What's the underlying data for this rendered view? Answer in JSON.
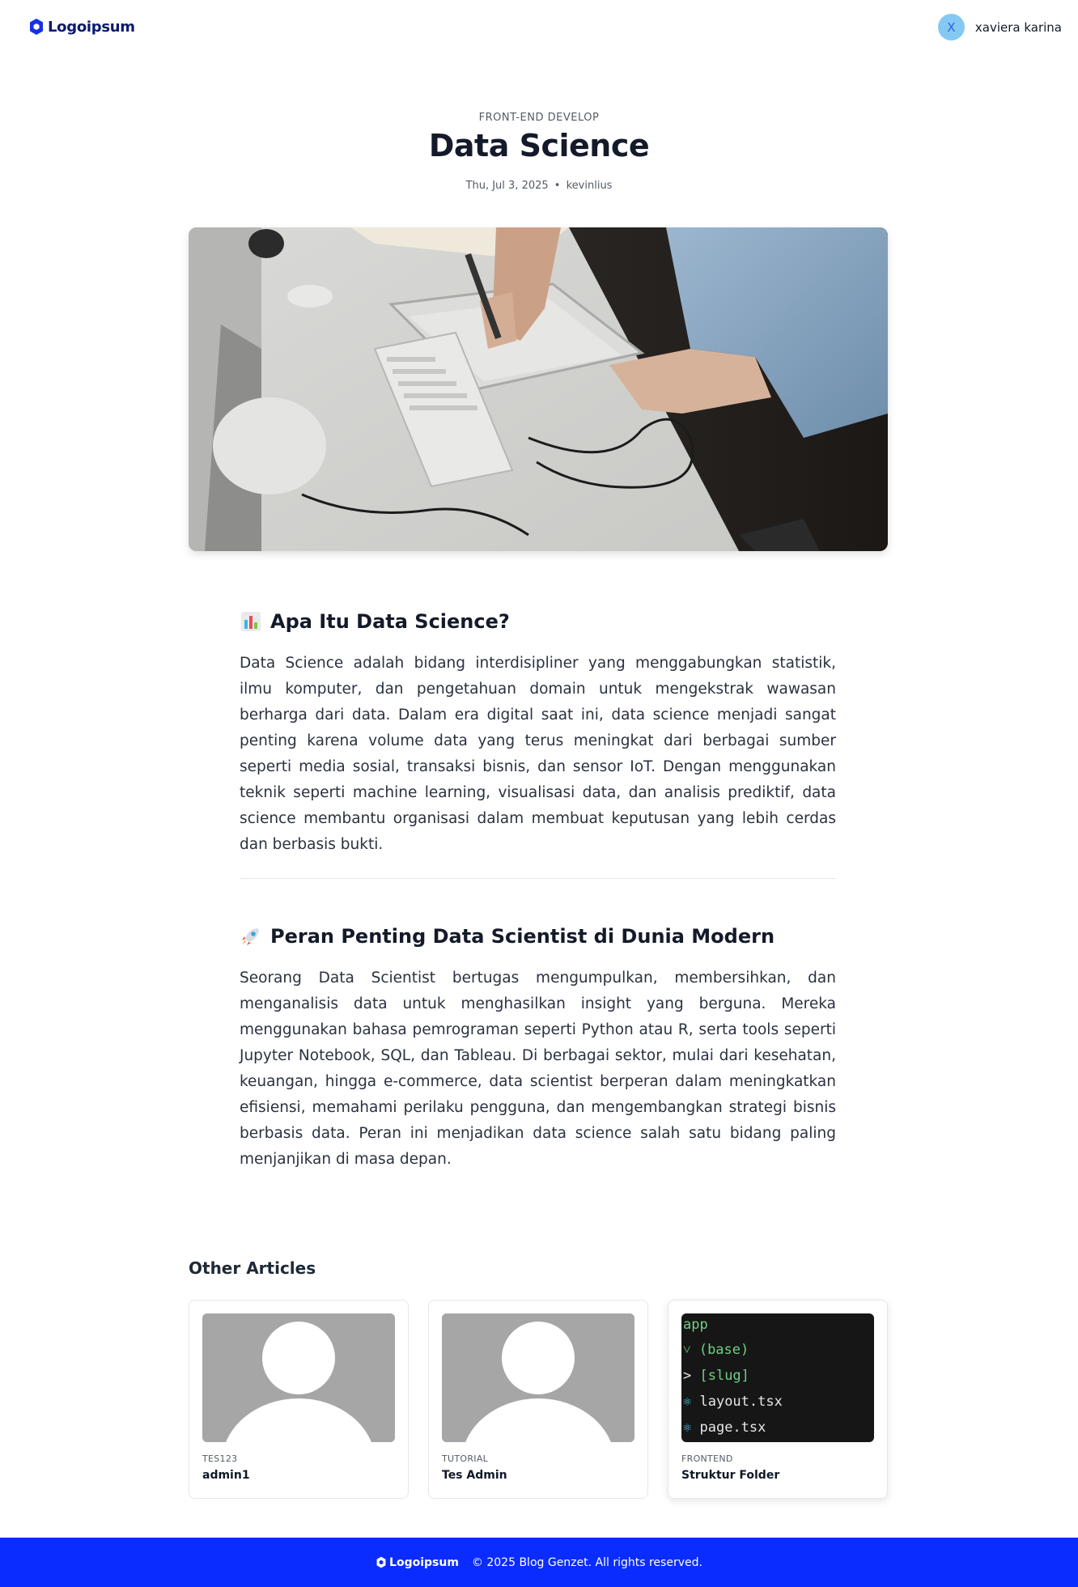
{
  "header": {
    "logo_text": "Logoipsum",
    "user": {
      "initial": "X",
      "name": "xaviera karina",
      "avatar_color": "#84c9f2"
    }
  },
  "article": {
    "category": "FRONT-END DEVELOP",
    "title": "Data Science",
    "date": "Thu, Jul 3, 2025",
    "separator": "•",
    "author": "kevinlius",
    "hero_image": "person-drawing-on-tablet-photo",
    "sections": [
      {
        "emoji": "chart-emoji-icon",
        "heading": "Apa Itu Data Science?",
        "body": "Data Science adalah bidang interdisipliner yang menggabungkan statistik, ilmu komputer, dan pengetahuan domain untuk mengekstrak wawasan berharga dari data. Dalam era digital saat ini, data science menjadi sangat penting karena volume data yang terus meningkat dari berbagai sumber seperti media sosial, transaksi bisnis, dan sensor IoT. Dengan menggunakan teknik seperti machine learning, visualisasi data, dan analisis prediktif, data science membantu organisasi dalam membuat keputusan yang lebih cerdas dan berbasis bukti."
      },
      {
        "emoji": "rocket-emoji-icon",
        "heading": "Peran Penting Data Scientist di Dunia Modern",
        "body": "Seorang Data Scientist bertugas mengumpulkan, membersihkan, dan menganalisis data untuk menghasilkan insight yang berguna. Mereka menggunakan bahasa pemrograman seperti Python atau R, serta tools seperti Jupyter Notebook, SQL, dan Tableau. Di berbagai sektor, mulai dari kesehatan, keuangan, hingga e-commerce, data scientist berperan dalam meningkatkan efisiensi, memahami perilaku pengguna, dan mengembangkan strategi bisnis berbasis data. Peran ini menjadikan data science salah satu bidang paling menjanjikan di masa depan."
      }
    ]
  },
  "other_articles": {
    "title": "Other Articles",
    "cards": [
      {
        "category": "TES123",
        "title": "admin1",
        "thumb": "placeholder-avatar"
      },
      {
        "category": "TUTORIAL",
        "title": "Tes Admin",
        "thumb": "placeholder-avatar"
      },
      {
        "category": "FRONTEND",
        "title": "Struktur Folder",
        "thumb": "code-tree",
        "code_lines": [
          "app",
          "(base)",
          "[slug]",
          "layout.tsx",
          "page.tsx"
        ]
      }
    ]
  },
  "footer": {
    "logo_text": "Logoipsum",
    "copyright": "© 2025 Blog Genzet. All rights reserved.",
    "background": "#0a2cff"
  }
}
